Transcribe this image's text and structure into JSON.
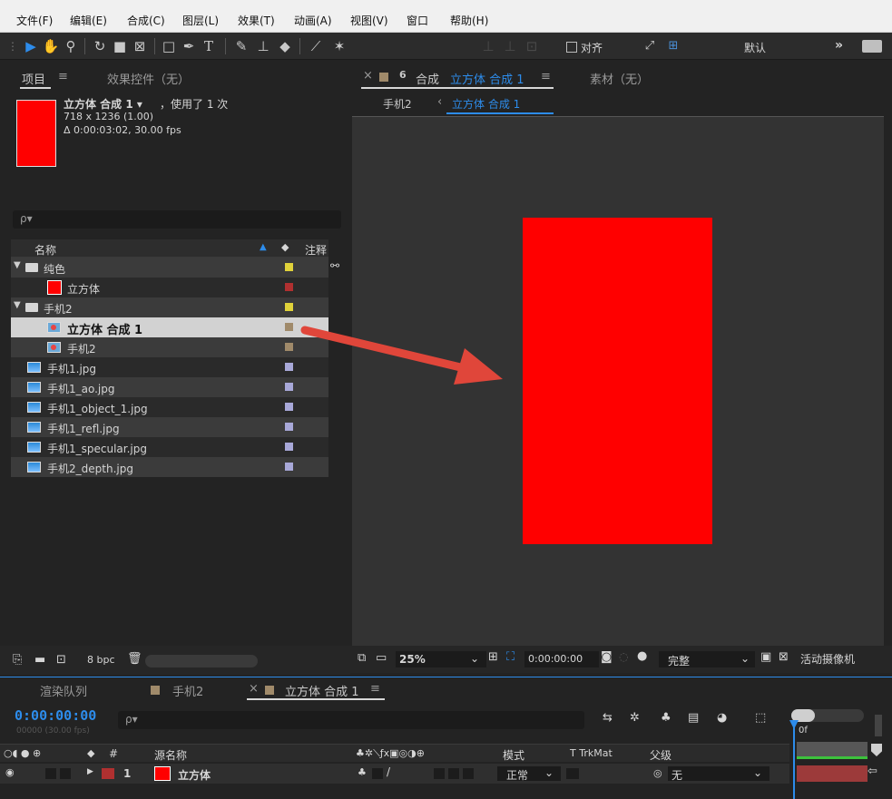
{
  "menu": [
    "文件(F)",
    "编辑(E)",
    "合成(C)",
    "图层(L)",
    "效果(T)",
    "动画(A)",
    "视图(V)",
    "窗口",
    "帮助(H)"
  ],
  "toolbar": {
    "align_label": "对齐",
    "workspace": "默认",
    "more": "»"
  },
  "project_panel": {
    "tab_project": "项目",
    "tab_menu": "≡",
    "tab_effects": "效果控件（无）",
    "selected_name": "立方体 合成 1 ▾",
    "used_text": "，使用了 1 次",
    "dims": "718 x 1236 (1.00)",
    "duration": "Δ 0:00:03:02, 30.00 fps",
    "thumb_color": "#ff0000",
    "search_placeholder": "ρ▾",
    "col_name": "名称",
    "col_comment": "注释",
    "items": [
      {
        "label": "纯色",
        "type": "folder",
        "swatch": "#e0d23a"
      },
      {
        "label": "立方体",
        "type": "solid",
        "swatch": "#b03030"
      },
      {
        "label": "手机2",
        "type": "folder",
        "swatch": "#e0d23a"
      },
      {
        "label": "立方体 合成 1",
        "type": "comp",
        "swatch": "#a08a6a"
      },
      {
        "label": "手机2",
        "type": "comp",
        "swatch": "#a08a6a"
      },
      {
        "label": "手机1.jpg",
        "type": "image",
        "swatch": "#a8a8d8"
      },
      {
        "label": "手机1_ao.jpg",
        "type": "image",
        "swatch": "#a8a8d8"
      },
      {
        "label": "手机1_object_1.jpg",
        "type": "image",
        "swatch": "#a8a8d8"
      },
      {
        "label": "手机1_refl.jpg",
        "type": "image",
        "swatch": "#a8a8d8"
      },
      {
        "label": "手机1_specular.jpg",
        "type": "image",
        "swatch": "#a8a8d8"
      },
      {
        "label": "手机2_depth.jpg",
        "type": "image",
        "swatch": "#a8a8d8"
      }
    ],
    "bpc": "8 bpc"
  },
  "comp_panel": {
    "close": "×",
    "lock": "6",
    "tab_prefix": "合成",
    "tab_name": "立方体 合成 1",
    "tab_menu": "≡",
    "footage_tab": "素材（无）",
    "breadcrumb_parent": "手机2",
    "breadcrumb_sep": "‹",
    "breadcrumb_current": "立方体 合成 1",
    "comp_color": "#ff0000",
    "arrow_color": "#e0463a"
  },
  "viewer_bar": {
    "zoom": "25%",
    "timecode": "0:00:00:00",
    "resolution": "完整",
    "camera": "活动摄像机"
  },
  "timeline": {
    "tab_render": "渲染队列",
    "tab_phone": "手机2",
    "tab_comp": "立方体 合成 1",
    "tab_menu": "≡",
    "close": "×",
    "timecode": "0:00:00:00",
    "frame_info": "00000 (30.00 fps)",
    "search_placeholder": "ρ▾",
    "col_hash": "#",
    "col_source": "源名称",
    "col_mode": "模式",
    "col_trkmat": "T  TrkMat",
    "col_parent": "父级",
    "layer_num": "1",
    "layer_name": "立方体",
    "layer_mode": "正常",
    "layer_parent": "无",
    "ruler_label": "0f",
    "layer_bar_color": "#9c3a3a"
  }
}
